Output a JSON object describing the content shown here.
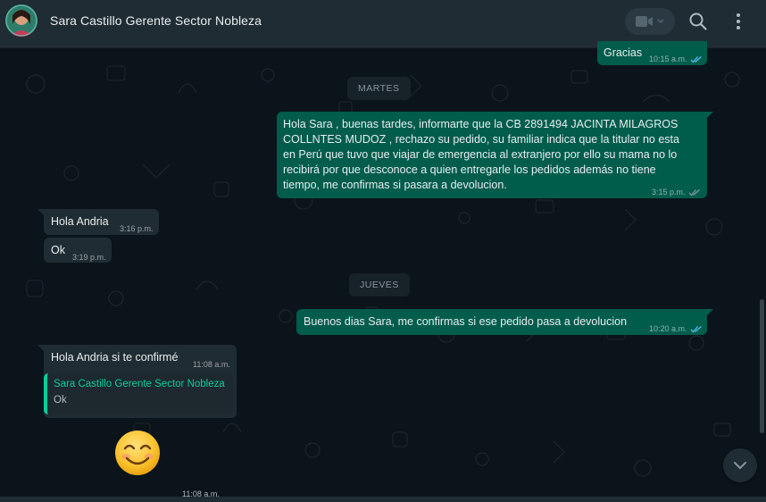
{
  "header": {
    "contact_name": "Sara Castillo Gerente Sector Nobleza",
    "icons": [
      "video-call-icon",
      "search-icon",
      "menu-icon"
    ]
  },
  "colors": {
    "outgoing_bubble": "#005c4b",
    "incoming_bubble": "#202c33",
    "accent": "#06cf9c",
    "chat_background": "#0b141a"
  },
  "messages": {
    "m1": {
      "text": "Gracias",
      "time": "10:15 a.m.",
      "status": "read"
    },
    "date1": "MARTES",
    "m2": {
      "lines": [
        "Hola Sara , buenas tardes, informarte que la  CB 2891494 JACINTA MILAGROS",
        "COLLNTES MUDOZ , rechazo su pedido, su familiar indica que la titular no esta",
        "en Perú que tuvo que viajar de emergencia al extranjero por ello su mama no lo",
        "recibirá por que  desconoce a quien entregarle los pedidos además no tiene",
        "tiempo, me confirmas si pasara a devolucion."
      ],
      "time": "3:15 p.m.",
      "status": "read"
    },
    "m3": {
      "text": "Hola Andria",
      "time": "3:16 p.m."
    },
    "m4": {
      "text": "Ok",
      "time": "3:19 p.m."
    },
    "date2": "JUEVES",
    "m5": {
      "text": "Buenos dias Sara, me confirmas si ese pedido pasa a devolucion",
      "time": "10:20 a.m.",
      "status": "read"
    },
    "m6": {
      "text": "Hola Andria si te confirmé",
      "time": "11:08 a.m."
    },
    "quote": {
      "author": "Sara Castillo Gerente Sector Nobleza",
      "text": "Ok"
    },
    "m7": {
      "emoji": "smiling-face-icon",
      "time": "11:08 a.m."
    }
  }
}
